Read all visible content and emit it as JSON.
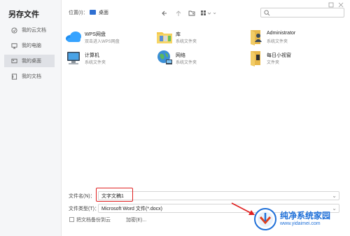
{
  "dialog": {
    "title": "另存文件"
  },
  "sidebar": {
    "items": [
      {
        "label": "我的云文档",
        "icon": "cloud-doc-icon"
      },
      {
        "label": "我的电脑",
        "icon": "monitor-icon"
      },
      {
        "label": "我的桌面",
        "icon": "desktop-icon",
        "active": true
      },
      {
        "label": "我的文档",
        "icon": "document-icon"
      }
    ]
  },
  "toolbar": {
    "location_label": "位置(I)：",
    "location_value": "桌面",
    "icons": [
      "back-arrow-icon",
      "up-arrow-icon",
      "new-folder-icon",
      "view-mode-icon"
    ]
  },
  "files": [
    {
      "name": "WPS网盘",
      "type": "双击进入WPS网盘",
      "icon": "cloud-drive-icon"
    },
    {
      "name": "库",
      "type": "系统文件夹",
      "icon": "library-folder-icon"
    },
    {
      "name": "Administrator",
      "type": "系统文件夹",
      "icon": "user-folder-icon"
    },
    {
      "name": "计算机",
      "type": "系统文件夹",
      "icon": "computer-icon"
    },
    {
      "name": "网络",
      "type": "系统文件夹",
      "icon": "network-icon"
    },
    {
      "name": "每日小视窗",
      "type": "文件夹",
      "icon": "folder-icon"
    }
  ],
  "form": {
    "filename_label": "文件名(N)：",
    "filename_value": "文字文稿1",
    "filetype_label": "文件类型(T)：",
    "filetype_value": "Microsoft Word 文件(*.docx)",
    "backup_checkbox_label": "把文档备份到云",
    "encrypt_link": "加密(E)..."
  },
  "watermark": {
    "title": "纯净系统家园",
    "url": "www.yidaimei.com"
  },
  "colors": {
    "highlight_border": "#e02020",
    "watermark_blue": "#1e6fd8",
    "sidebar_active": "#dfe1e6"
  }
}
